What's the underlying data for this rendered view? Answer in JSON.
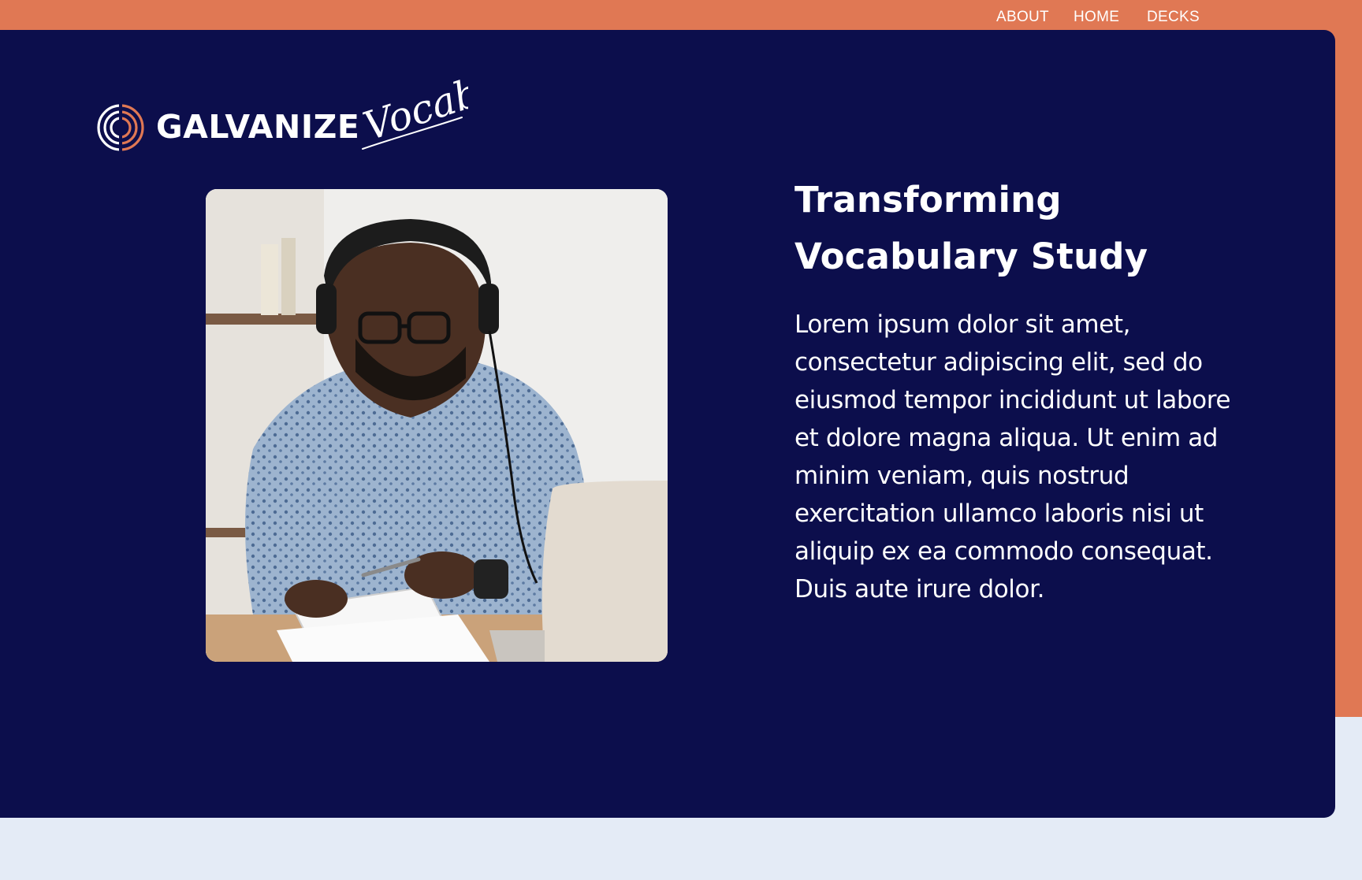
{
  "nav": {
    "about": "ABOUT",
    "home": "HOME",
    "decks": "DECKS"
  },
  "brand": {
    "wordmark": "GALVANIZE",
    "script": "Vocab"
  },
  "hero": {
    "title": "Transforming Vocabulary Study",
    "body": "Lorem ipsum dolor sit amet, consectetur adipiscing elit, sed do eiusmod tempor incididunt ut labore et dolore magna aliqua. Ut enim ad minim veniam, quis nostrud exercitation ullamco laboris nisi ut aliquip ex ea commodo consequat. Duis aute irure dolor."
  },
  "colors": {
    "accent_orange": "#e07854",
    "hero_navy": "#0c0e4c",
    "page_background": "#e4ebf6",
    "text": "#ffffff"
  },
  "icons": {
    "logo": "galvanize-logo-icon"
  }
}
